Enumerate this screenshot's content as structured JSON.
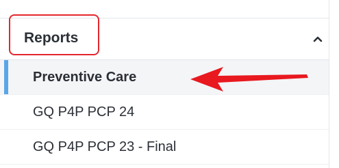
{
  "reports_section": {
    "title": "Reports",
    "collapse_icon": "chevron-up-icon",
    "items": [
      {
        "label": "Preventive Care",
        "active": true
      },
      {
        "label": "GQ P4P PCP 24",
        "active": false
      },
      {
        "label": "GQ P4P PCP 23 - Final",
        "active": false
      }
    ]
  },
  "colors": {
    "highlight_border": "#e4262d",
    "annotation_arrow": "#e8191f",
    "active_indicator": "#5aa6e8",
    "active_background": "#f4f5f7",
    "text": "#2b2f36"
  }
}
